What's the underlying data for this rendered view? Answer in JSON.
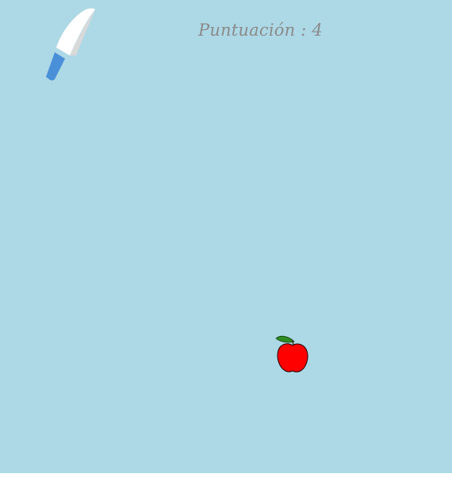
{
  "game": {
    "background_color": "#add8e6",
    "score_label": "Puntuación",
    "score_separator": " : ",
    "score_value": "4",
    "score_color": "#8a8a8a"
  },
  "sprites": {
    "knife": {
      "icon": "knife-icon",
      "blade_color": "#ffffff",
      "blade_shadow_color": "#d9d9d9",
      "handle_color": "#4a90d9"
    },
    "apple": {
      "icon": "apple-icon",
      "body_color": "#ff0000",
      "leaf_color": "#2e8b22"
    }
  }
}
